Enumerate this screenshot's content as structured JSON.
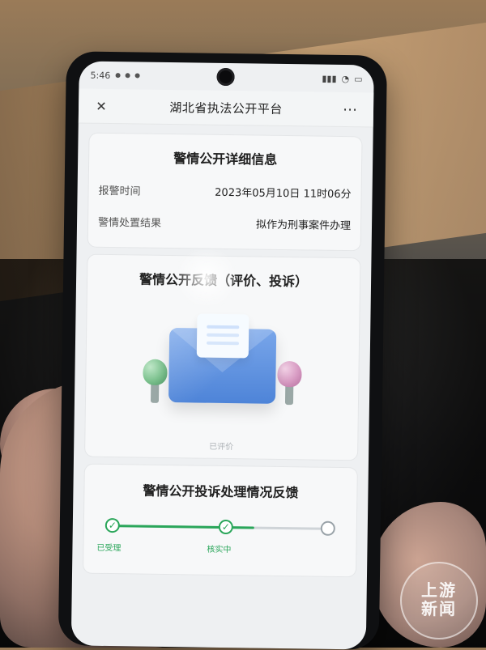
{
  "status_bar": {
    "time": "5:46",
    "left_icons": [
      "notification-dot",
      "notification-dot",
      "notification-dot"
    ],
    "right_icons": [
      "signal-icon",
      "wifi-icon",
      "battery-icon"
    ]
  },
  "header": {
    "close_icon": "close-icon",
    "title": "湖北省执法公开平台",
    "more_icon": "more-icon"
  },
  "details": {
    "section_title": "警情公开详细信息",
    "rows": [
      {
        "label": "报警时间",
        "value": "2023年05月10日 11时06分"
      },
      {
        "label": "警情处置结果",
        "value": "拟作为刑事案件办理"
      }
    ]
  },
  "feedback": {
    "title": "警情公开反馈（评价、投诉）",
    "caption": "已评价"
  },
  "progress": {
    "title": "警情公开投诉处理情况反馈",
    "steps": [
      {
        "label": "已受理",
        "state": "done"
      },
      {
        "label": "核实中",
        "state": "done"
      },
      {
        "label": "",
        "state": "pending"
      }
    ],
    "progress_fraction": 0.58
  },
  "watermark": {
    "line1": "上游",
    "line2": "新闻"
  },
  "colors": {
    "accent_green": "#2aa65a",
    "envelope_blue": "#4e84d8",
    "screen_bg": "#eef0f2"
  }
}
